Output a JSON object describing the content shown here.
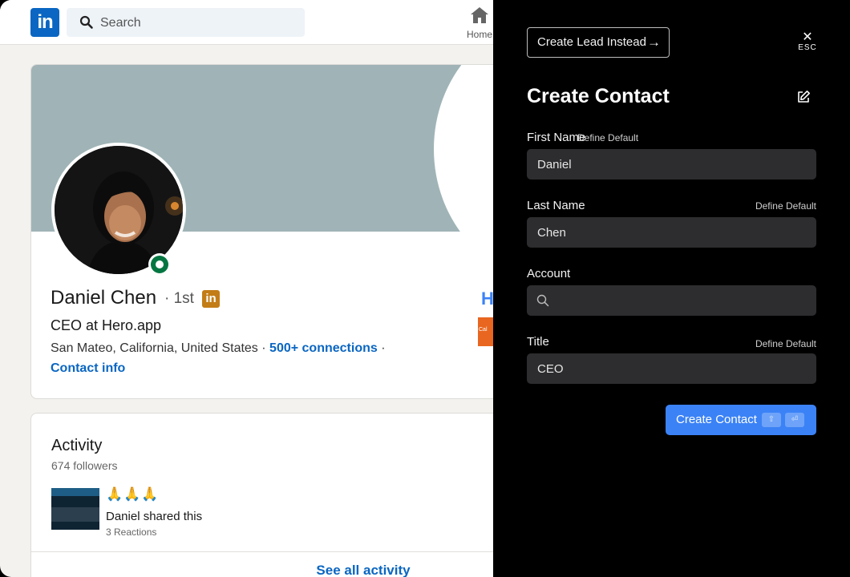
{
  "linkedin": {
    "logo": "in",
    "search_placeholder": "Search",
    "nav_home": "Home",
    "profile": {
      "name": "Daniel Chen",
      "degree": "· 1st",
      "badge": "in",
      "headline": "CEO at Hero.app",
      "location": "San Mateo, California, United States",
      "connections": "500+ connections",
      "contact_info": "Contact info",
      "company_logo_letter": "H",
      "edu_logo_text": "Cal"
    },
    "activity": {
      "title": "Activity",
      "followers": "674 followers",
      "post_emoji": "🙏🙏🙏",
      "post_text": "Daniel shared this",
      "reactions": "3 Reactions",
      "see_all": "See all activity"
    }
  },
  "panel": {
    "create_lead_label": "Create Lead Instead",
    "create_lead_arrow": "→",
    "esc_x": "✕",
    "esc_label": "ESC",
    "title": "Create Contact",
    "fields": {
      "first_name": {
        "label": "First Name",
        "default_link": "Define Default",
        "value": "Daniel"
      },
      "last_name": {
        "label": "Last Name",
        "default_link": "Define Default",
        "value": "Chen"
      },
      "account": {
        "label": "Account",
        "value": ""
      },
      "title": {
        "label": "Title",
        "default_link": "Define Default",
        "value": "CEO"
      }
    },
    "submit": {
      "label": "Create Contact",
      "key1": "⇧",
      "key2": "⏎"
    }
  },
  "colors": {
    "accent": "#3b82f6",
    "linkedin_blue": "#0a66c2",
    "panel_bg": "#000000",
    "field_bg": "#2d2d2f",
    "online_green": "#057642"
  }
}
